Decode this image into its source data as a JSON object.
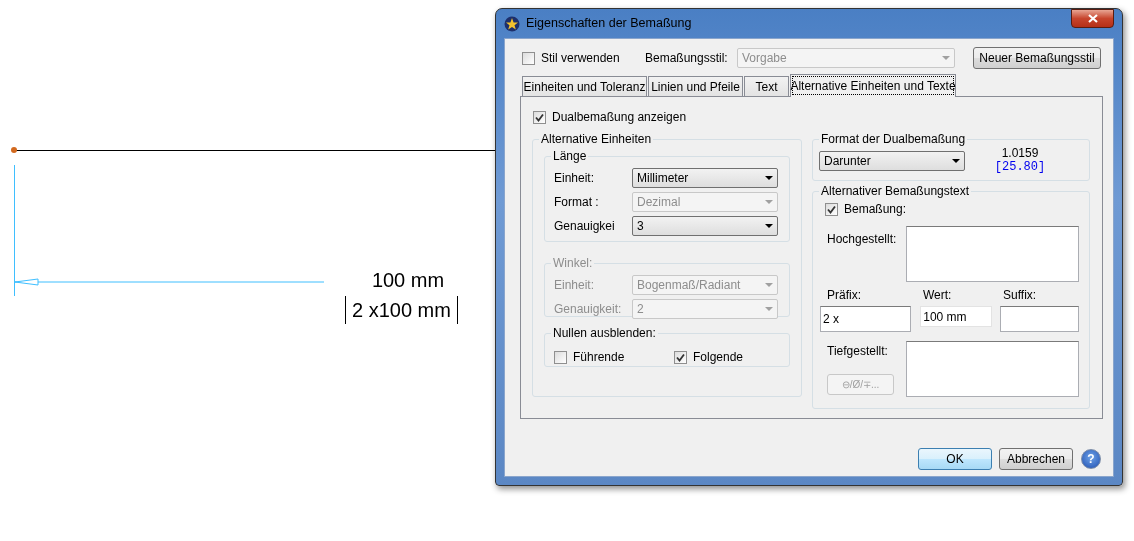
{
  "canvas": {
    "dimension_text": "100 mm",
    "alt_dimension_text": "2 x100 mm"
  },
  "dialog": {
    "title": "Eigenschaften der Bemaßung",
    "use_style": {
      "label": "Stil verwenden",
      "checked": false
    },
    "style_label": "Bemaßungsstil:",
    "style_select": {
      "value": "Vorgabe",
      "disabled": true
    },
    "new_style_button": "Neuer Bemaßungsstil",
    "tabs": [
      {
        "label": "Einheiten und Toleranz",
        "selected": false
      },
      {
        "label": "Linien und Pfeile",
        "selected": false
      },
      {
        "label": "Text",
        "selected": false
      },
      {
        "label": "Alternative Einheiten und Texte",
        "selected": true
      }
    ],
    "show_dual": {
      "label": "Dualbemaßung anzeigen",
      "checked": true
    },
    "alt_units": {
      "title": "Alternative Einheiten",
      "groups": [
        {
          "title": "Länge",
          "disabled": false,
          "fields": [
            {
              "label": "Einheit:",
              "value": "Millimeter",
              "disabled": false
            },
            {
              "label": "Format :",
              "value": "Dezimal",
              "disabled": true
            },
            {
              "label": "Genauigkei",
              "value": "3",
              "disabled": false
            }
          ]
        },
        {
          "title": "Winkel:",
          "disabled": true,
          "fields": [
            {
              "label": "Einheit:",
              "value": "Bogenmaß/Radiant",
              "disabled": true
            },
            {
              "label": "Genauigkeit:",
              "value": "2",
              "disabled": true
            }
          ]
        }
      ],
      "zeros": {
        "title": "Nullen ausblenden:",
        "options": [
          {
            "label": "Führende",
            "checked": false
          },
          {
            "label": "Folgende",
            "checked": true
          }
        ]
      }
    },
    "dual_format": {
      "title": "Format der Dualbemaßung",
      "value": "Darunter",
      "preview_primary": "1.0159",
      "preview_alt": "[25.80]"
    },
    "alt_text": {
      "title": "Alternativer Bemaßungstext",
      "checkbox": {
        "label": "Bemaßung:",
        "checked": true
      },
      "superscript_label": "Hochgestellt:",
      "prefix_label": "Präfix:",
      "value_label": "Wert:",
      "suffix_label": "Suffix:",
      "prefix": "2 x",
      "value": "100 mm",
      "subscript_label": "Tiefgestellt:",
      "symbol_button": {
        "label": "⊖/Ø/∓...",
        "disabled": true
      }
    },
    "buttons": [
      {
        "label": "OK",
        "default": true
      },
      {
        "label": "Abbrechen",
        "default": false
      }
    ],
    "help_button": "?"
  }
}
